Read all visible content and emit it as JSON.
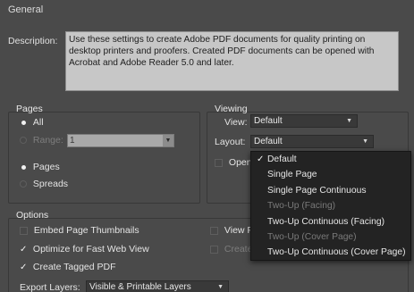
{
  "general": {
    "title": "General",
    "description_label": "Description:",
    "description_text": "Use these settings to create Adobe PDF documents for quality printing on desktop printers and proofers.  Created PDF documents can be opened with Acrobat and Adobe Reader 5.0 and later."
  },
  "pages": {
    "title": "Pages",
    "all_label": "All",
    "range_label": "Range:",
    "range_value": "1",
    "pages_label": "Pages",
    "spreads_label": "Spreads"
  },
  "viewing": {
    "title": "Viewing",
    "view_label": "View:",
    "view_value": "Default",
    "layout_label": "Layout:",
    "layout_value": "Default",
    "open_label": "Open"
  },
  "layout_menu": {
    "items": [
      {
        "label": "Default",
        "checked": true,
        "disabled": false
      },
      {
        "label": "Single Page",
        "checked": false,
        "disabled": false
      },
      {
        "label": "Single Page Continuous",
        "checked": false,
        "disabled": false
      },
      {
        "label": "Two-Up (Facing)",
        "checked": false,
        "disabled": true
      },
      {
        "label": "Two-Up Continuous (Facing)",
        "checked": false,
        "disabled": false
      },
      {
        "label": "Two-Up (Cover Page)",
        "checked": false,
        "disabled": true
      },
      {
        "label": "Two-Up Continuous (Cover Page)",
        "checked": false,
        "disabled": false
      }
    ]
  },
  "options": {
    "title": "Options",
    "embed_thumbnails": "Embed Page Thumbnails",
    "optimize_web": "Optimize for Fast Web View",
    "create_tagged": "Create Tagged PDF",
    "view_partial": "View F",
    "create_partial": "Create",
    "export_layers_label": "Export Layers:",
    "export_layers_value": "Visible & Printable Layers"
  },
  "glyphs": {
    "check": "✓",
    "arrow_down": "▼"
  }
}
